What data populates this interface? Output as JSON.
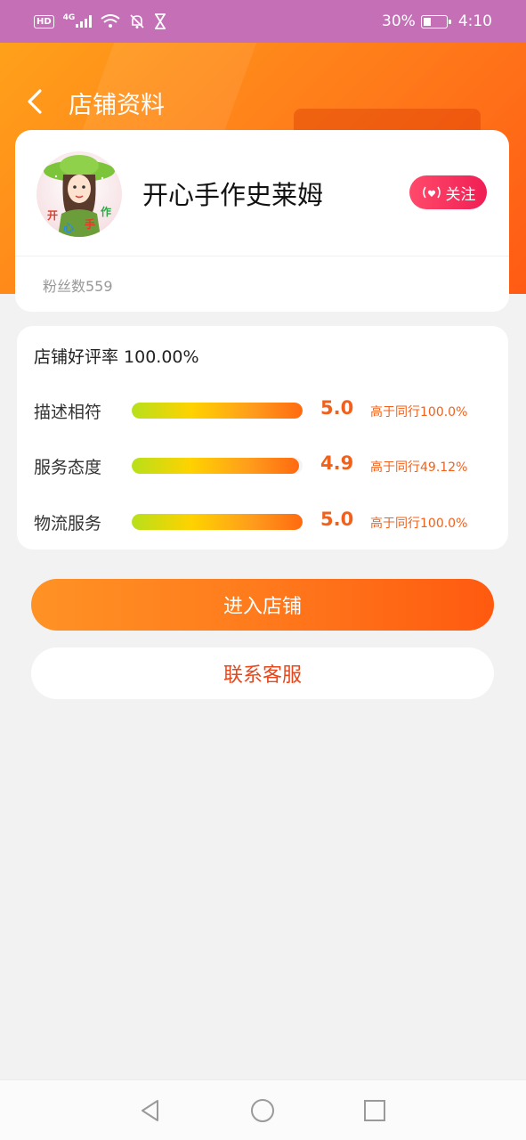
{
  "status_bar": {
    "left_icons": [
      "hd-icon",
      "4g-signal-icon",
      "wifi-icon",
      "mute-bell-icon",
      "hourglass-icon"
    ],
    "hd": "HD",
    "network": "4G",
    "battery_percent": "30%",
    "time": "4:10"
  },
  "header": {
    "back_icon": "back-arrow-icon",
    "title": "店铺资料"
  },
  "shop": {
    "avatar_text": [
      "开",
      "心",
      "手",
      "作"
    ],
    "name": "开心手作史莱姆",
    "follow_label": "关注",
    "follow_icon": "broadcast-heart-icon",
    "fans": "粉丝数559"
  },
  "ratings": {
    "good_rate": "店铺好评率 100.00%",
    "items": [
      {
        "label": "描述相符",
        "score": "5.0",
        "fill": 1.0,
        "compare": "高于同行100.0%"
      },
      {
        "label": "服务态度",
        "score": "4.9",
        "fill": 0.98,
        "compare": "高于同行49.12%"
      },
      {
        "label": "物流服务",
        "score": "5.0",
        "fill": 1.0,
        "compare": "高于同行100.0%"
      }
    ]
  },
  "actions": {
    "enter_label": "进入店铺",
    "contact_label": "联系客服"
  },
  "nav": {
    "icons": [
      "nav-back-icon",
      "nav-home-icon",
      "nav-recents-icon"
    ]
  },
  "colors": {
    "status_bar": "#c56fb7",
    "accent_orange": "#ff7a1a",
    "score_orange": "#f2611b",
    "follow_pink": "#f01e55"
  }
}
